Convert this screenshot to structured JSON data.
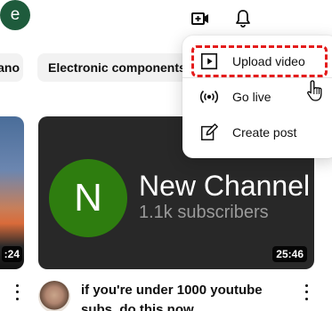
{
  "header": {
    "create_icon": "video-plus-icon",
    "notifications_icon": "bell-icon",
    "avatar_letter": "e",
    "avatar_color": "#1e5b3c"
  },
  "chips": [
    {
      "label": "ano"
    },
    {
      "label": "Electronic components"
    }
  ],
  "create_menu": {
    "items": [
      {
        "label": "Upload video",
        "icon": "upload-video-icon"
      },
      {
        "label": "Go live",
        "icon": "live-broadcast-icon"
      },
      {
        "label": "Create post",
        "icon": "edit-post-icon"
      }
    ],
    "highlight_color": "#e41b1b"
  },
  "videos": [
    {
      "duration": ":24"
    },
    {
      "thumbnail": {
        "avatar_letter": "N",
        "channel_name": "New Channel",
        "subscribers": "1.1k subscribers"
      },
      "duration": "25:46",
      "title": "if you're under 1000 youtube subs, do this now"
    }
  ]
}
